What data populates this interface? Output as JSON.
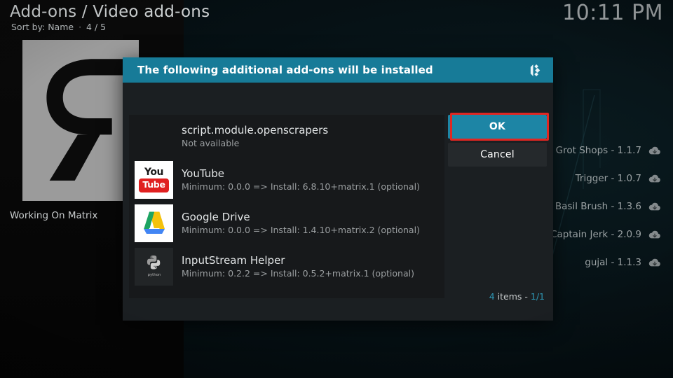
{
  "header": {
    "breadcrumb": "Add-ons / Video add-ons",
    "sort_label": "Sort by: Name",
    "sort_separator": "·",
    "position": "4 / 5",
    "clock": "10:11 PM"
  },
  "thumbnail": {
    "label": "Working On Matrix",
    "glyph": "Я",
    "icon_name": "mirrored-r-logo"
  },
  "sidebar": {
    "items": [
      {
        "label": "Grot Shops - 1.1.7",
        "icon": "cloud-download-icon"
      },
      {
        "label": "Trigger - 1.0.7",
        "icon": "cloud-download-icon"
      },
      {
        "label": "Basil Brush - 1.3.6",
        "icon": "cloud-download-icon"
      },
      {
        "label": "Captain Jerk - 2.0.9",
        "icon": "cloud-download-icon"
      },
      {
        "label": "gujal - 1.1.3",
        "icon": "cloud-download-icon"
      }
    ]
  },
  "dialog": {
    "title": "The following additional add-ons will be installed",
    "logo_icon": "kodi-logo-icon",
    "accent_color": "#177b98",
    "focus_ring_color": "#e02722",
    "addons": [
      {
        "name": "script.module.openscrapers",
        "detail": "Not available",
        "icon": "none"
      },
      {
        "name": "YouTube",
        "detail": "Minimum: 0.0.0 => Install: 6.8.10+matrix.1 (optional)",
        "icon": "youtube-logo-icon",
        "icon_you": "You",
        "icon_tube": "Tube"
      },
      {
        "name": "Google Drive",
        "detail": "Minimum: 0.0.0 => Install: 1.4.10+matrix.2 (optional)",
        "icon": "google-drive-logo-icon"
      },
      {
        "name": "InputStream Helper",
        "detail": "Minimum: 0.2.2 => Install: 0.5.2+matrix.1 (optional)",
        "icon": "python-logo-icon",
        "icon_caption": "python"
      }
    ],
    "count_number": "4",
    "count_label": "items -",
    "count_page": "1/1",
    "buttons": {
      "ok": "OK",
      "cancel": "Cancel"
    }
  }
}
